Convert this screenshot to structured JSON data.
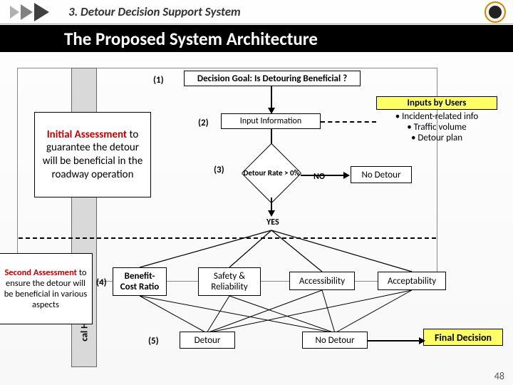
{
  "header": {
    "section": "3. Detour Decision Support System",
    "subtitle": "The Proposed System Architecture"
  },
  "nums": {
    "n1": "(1)",
    "n2": "(2)",
    "n3": "(3)",
    "n4": "(4)",
    "n5": "(5)"
  },
  "goal": "Decision Goal: Is Detouring Beneficial ?",
  "input_info": "Input Information",
  "inputs": {
    "title": "Inputs by Users",
    "a": "•   Incident-related info",
    "b": "•   Traffic volume",
    "c": "•   Detour plan"
  },
  "diamond": "Detour Rate > 0%",
  "yes": "YES",
  "no": "NO",
  "no_detour": "No Detour",
  "initial": {
    "lead": "Initial Assessment",
    "rest": " to guarantee the detour will be beneficial in the roadway operation"
  },
  "second": {
    "lead": "Second Assessment",
    "rest": " to ensure the detour will be beneficial in various aspects"
  },
  "criteria": {
    "bc": "Benefit-Cost Ratio",
    "sr": "Safety & Reliability",
    "ac": "Accessibility",
    "ap": "Acceptability"
  },
  "detour": "Detour",
  "no_detour2": "No Detour",
  "final": "Final Decision",
  "sidebar": "cal Hier",
  "page": "48"
}
